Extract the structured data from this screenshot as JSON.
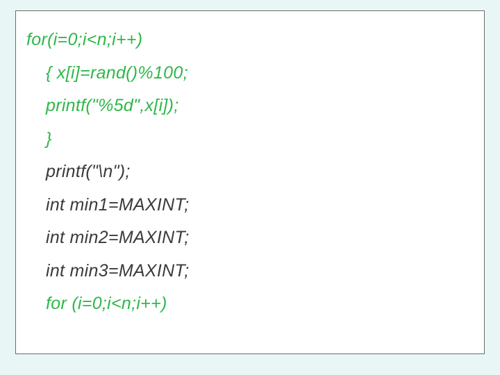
{
  "code": {
    "line1": "for(i=0;i<n;i++)",
    "line2": "{ x[i]=rand()%100;",
    "line3": "printf(\"%5d\",x[i]);",
    "line4": "}",
    "line5": "printf(\"\\n\");",
    "line6": "int min1=MAXINT;",
    "line7": "int min2=MAXINT;",
    "line8": "int min3=MAXINT;",
    "line9": "for (i=0;i<n;i++)"
  }
}
